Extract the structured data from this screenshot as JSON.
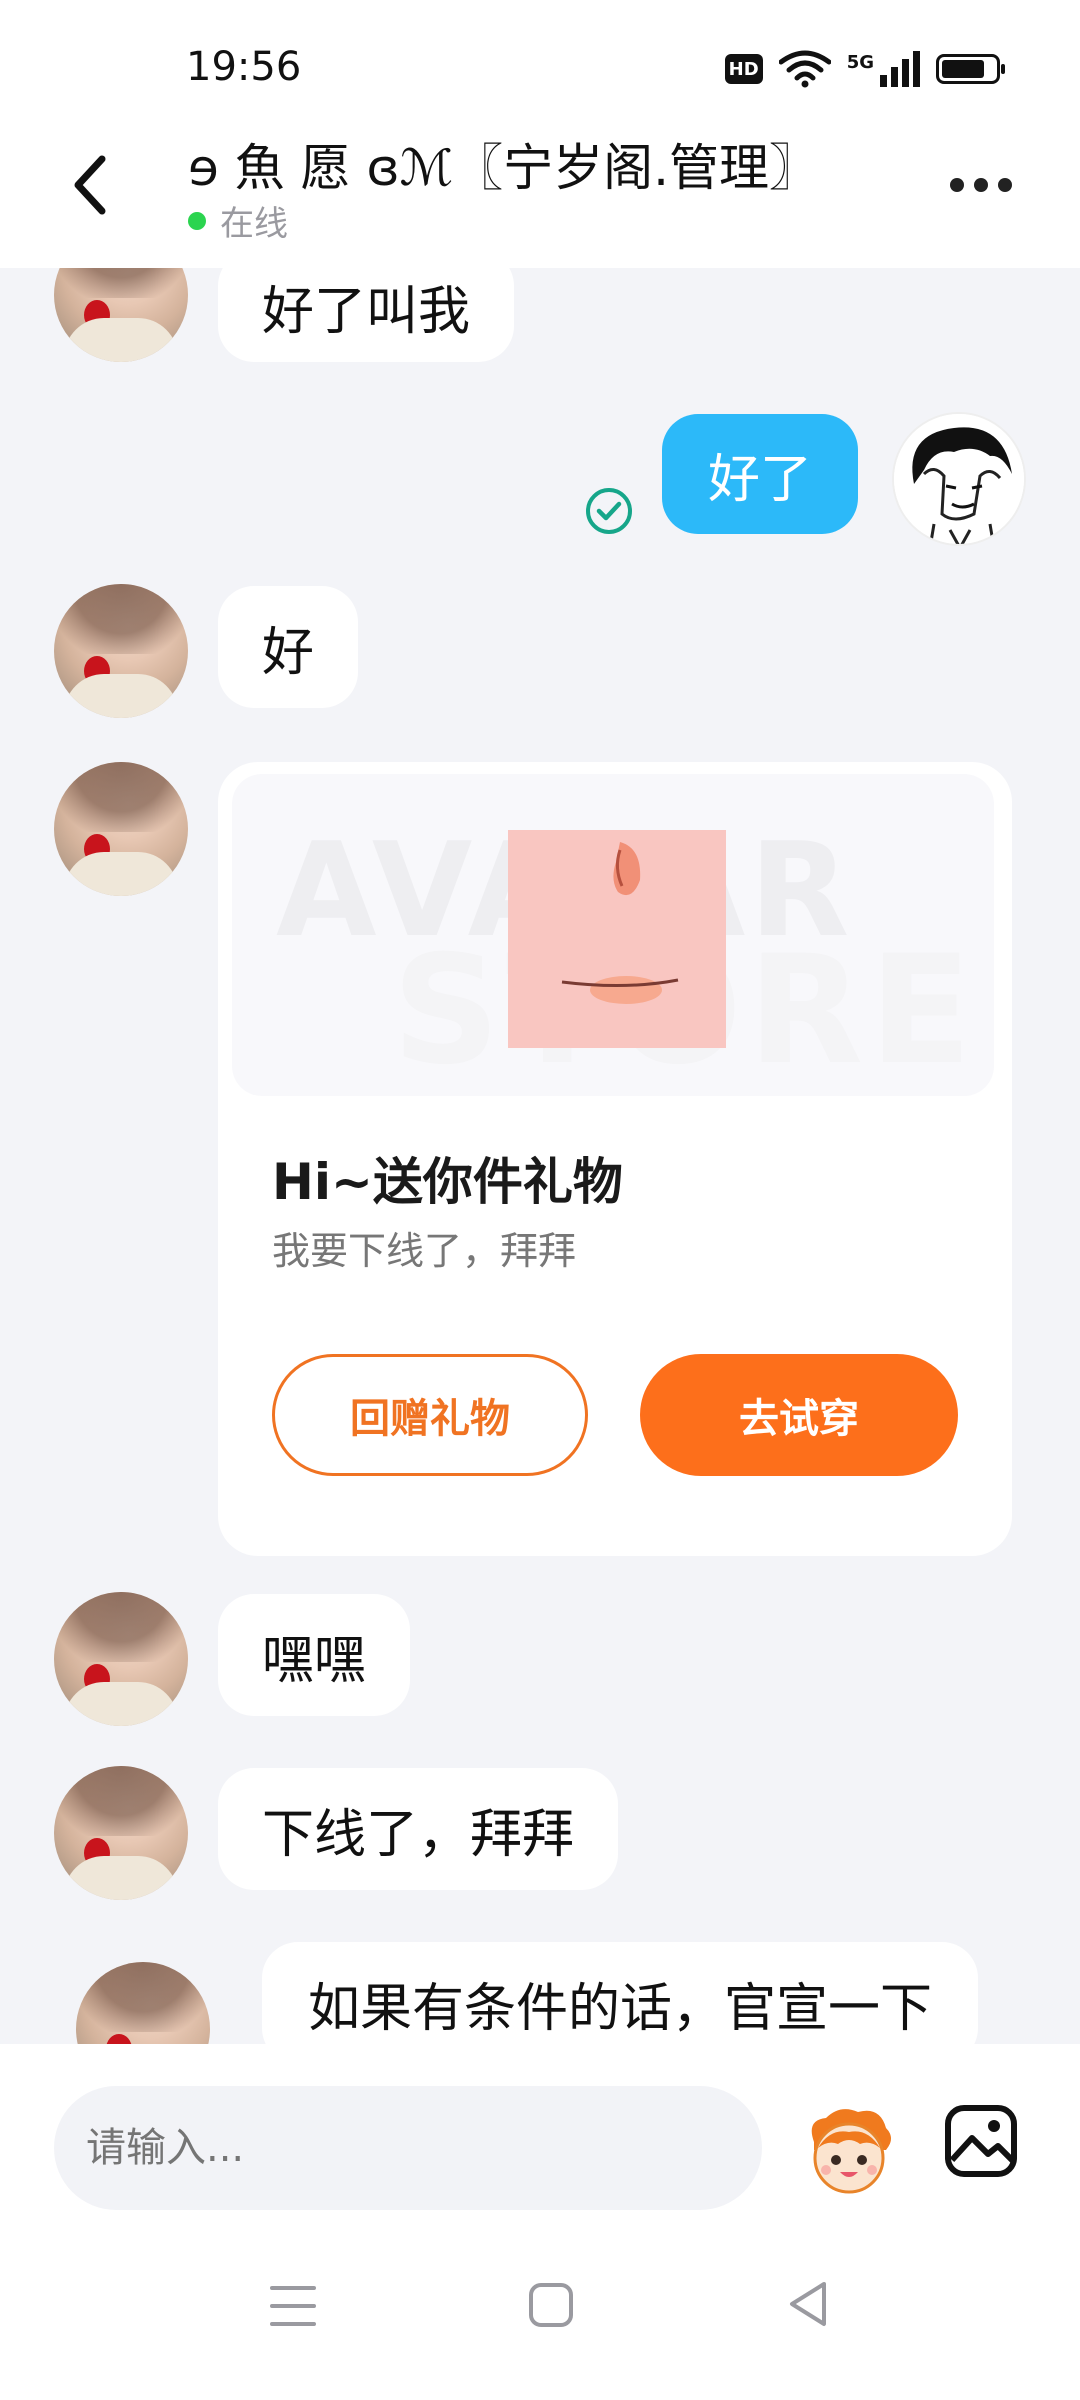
{
  "status_bar": {
    "time": "19:56",
    "hd": "HD",
    "network": "5G"
  },
  "header": {
    "title": "ɘ 魚 愿 ɞℳ〖宁岁阁.管理〗",
    "status": "在线"
  },
  "messages": [
    {
      "from": "other",
      "text": "好了叫我"
    },
    {
      "from": "me",
      "text": "好了",
      "status": "sent-check"
    },
    {
      "from": "other",
      "text": "好"
    },
    {
      "from": "other",
      "type": "gift-card",
      "watermark_top": "AVATAR",
      "watermark_bottom": "STORE",
      "title": "Hi~送你件礼物",
      "subtitle": "我要下线了，拜拜",
      "return_gift_label": "回赠礼物",
      "try_on_label": "去试穿"
    },
    {
      "from": "other",
      "text": "嘿嘿"
    },
    {
      "from": "other",
      "text": "下线了，拜拜"
    },
    {
      "from": "other",
      "text": "如果有条件的话，官宣一下"
    }
  ],
  "input": {
    "placeholder": "请输入..."
  },
  "icons": {
    "back": "chevron-left-icon",
    "more": "more-dots-icon",
    "emoji": "mascot-emoji-icon",
    "image": "image-icon",
    "check": "check-circle-icon"
  },
  "colors": {
    "my_bubble": "#2cb9f9",
    "accent_orange": "#fd6f1b",
    "online_dot": "#2bd44f",
    "check_green": "#16a68a"
  }
}
